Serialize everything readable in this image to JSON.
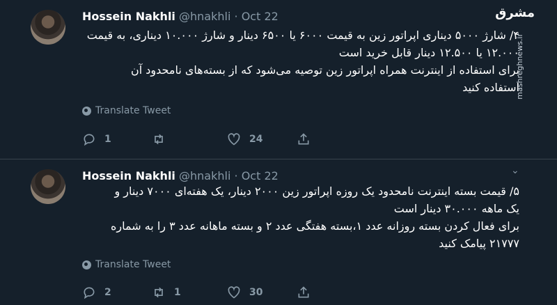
{
  "watermark": {
    "logo": "مشرق",
    "url": "mashreghnews.ir"
  },
  "tweets": [
    {
      "name": "Hossein Nakhli",
      "handle": "@hnakhli",
      "separator": "·",
      "date": "Oct 22",
      "lines": [
        "۴/ شارژ ۵۰۰۰ دیناری اپراتور زین به قیمت ۶۰۰۰ یا ۶۵۰۰ دینار و شارژ ۱۰.۰۰۰ دیناری، به قیمت",
        "۱۲.۰۰۰ یا ۱۲.۵۰۰ دینار قابل خرید است",
        "برای استفاده از اینترنت همراه اپراتور زین توصیه می‌شود که از بسته‌های نامحدود آن",
        "استفاده کنید"
      ],
      "translate": "Translate Tweet",
      "reply_count": "1",
      "retweet_count": "",
      "like_count": "24"
    },
    {
      "name": "Hossein Nakhli",
      "handle": "@hnakhli",
      "separator": "·",
      "date": "Oct 22",
      "chevron": "⌄",
      "lines": [
        "۵/ قیمت بسته اینترنت نامحدود یک روزه اپراتور زین ۲۰۰۰ دینار، یک هفته‌ای ۷۰۰۰ دینار و",
        "یک ماهه ۳۰.۰۰۰ دینار است",
        "برای فعال کردن بسته روزانه عدد ۱،بسته هفتگی عدد ۲ و بسته ماهانه عدد ۳ را به شماره",
        "۲۱۷۷۷ پیامک کنید"
      ],
      "translate": "Translate Tweet",
      "reply_count": "2",
      "retweet_count": "1",
      "like_count": "30"
    }
  ]
}
